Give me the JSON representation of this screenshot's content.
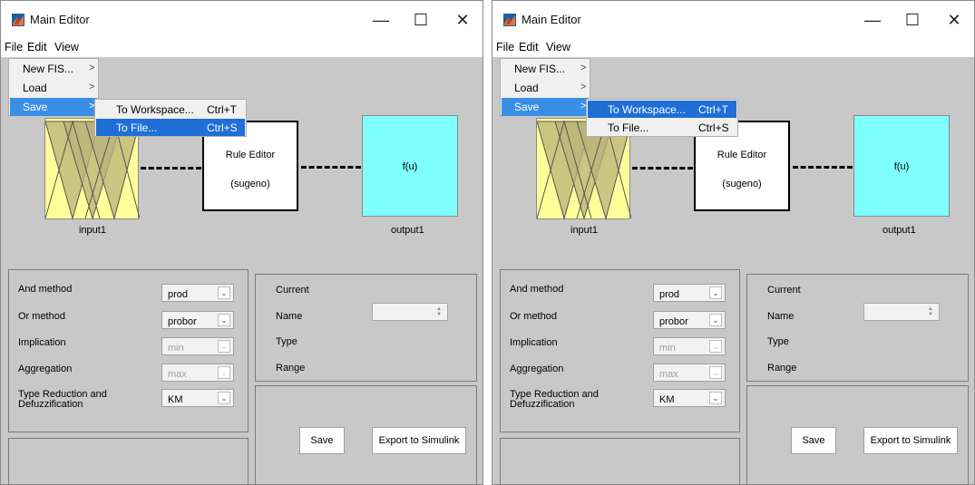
{
  "window": {
    "title": "Main Editor",
    "min_glyph": "—",
    "max_glyph": "☐",
    "close_glyph": "✕"
  },
  "menubar": [
    "File",
    "Edit",
    "View"
  ],
  "file_menu": {
    "items": [
      {
        "label": "New FIS...",
        "arrow": ">"
      },
      {
        "label": "Load",
        "arrow": ">"
      },
      {
        "label": "Save",
        "arrow": ">"
      }
    ]
  },
  "save_submenu": [
    {
      "label": "To Workspace...",
      "shortcut": "Ctrl+T"
    },
    {
      "label": "To File...",
      "shortcut": "Ctrl+S"
    }
  ],
  "diagram": {
    "input_label": "input1",
    "output_label": "output1",
    "rule_title": "Rule Editor",
    "rule_subtitle": "(sugeno)",
    "output_fn": "f(u)"
  },
  "fis_properties": [
    {
      "label": "And method",
      "value": "prod",
      "enabled": true
    },
    {
      "label": "Or method",
      "value": "probor",
      "enabled": true
    },
    {
      "label": "Implication",
      "value": "min",
      "enabled": false
    },
    {
      "label": "Aggregation",
      "value": "max",
      "enabled": false
    },
    {
      "label": "Type Reduction and\nDefuzzification",
      "value": "KM",
      "enabled": true
    }
  ],
  "current_variable": {
    "current_label": "Current",
    "name_label": "Name",
    "type_label": "Type",
    "range_label": "Range",
    "name_value": ""
  },
  "buttons": {
    "save": "Save",
    "export": "Export to Simulink"
  },
  "highlight": {
    "left": "To File...",
    "right": "To Workspace..."
  },
  "colors": {
    "background": "#c8c8c8",
    "input_box": "#ffff99",
    "output_box": "#80ffff",
    "menu_highlight": "#1f6fd6"
  }
}
